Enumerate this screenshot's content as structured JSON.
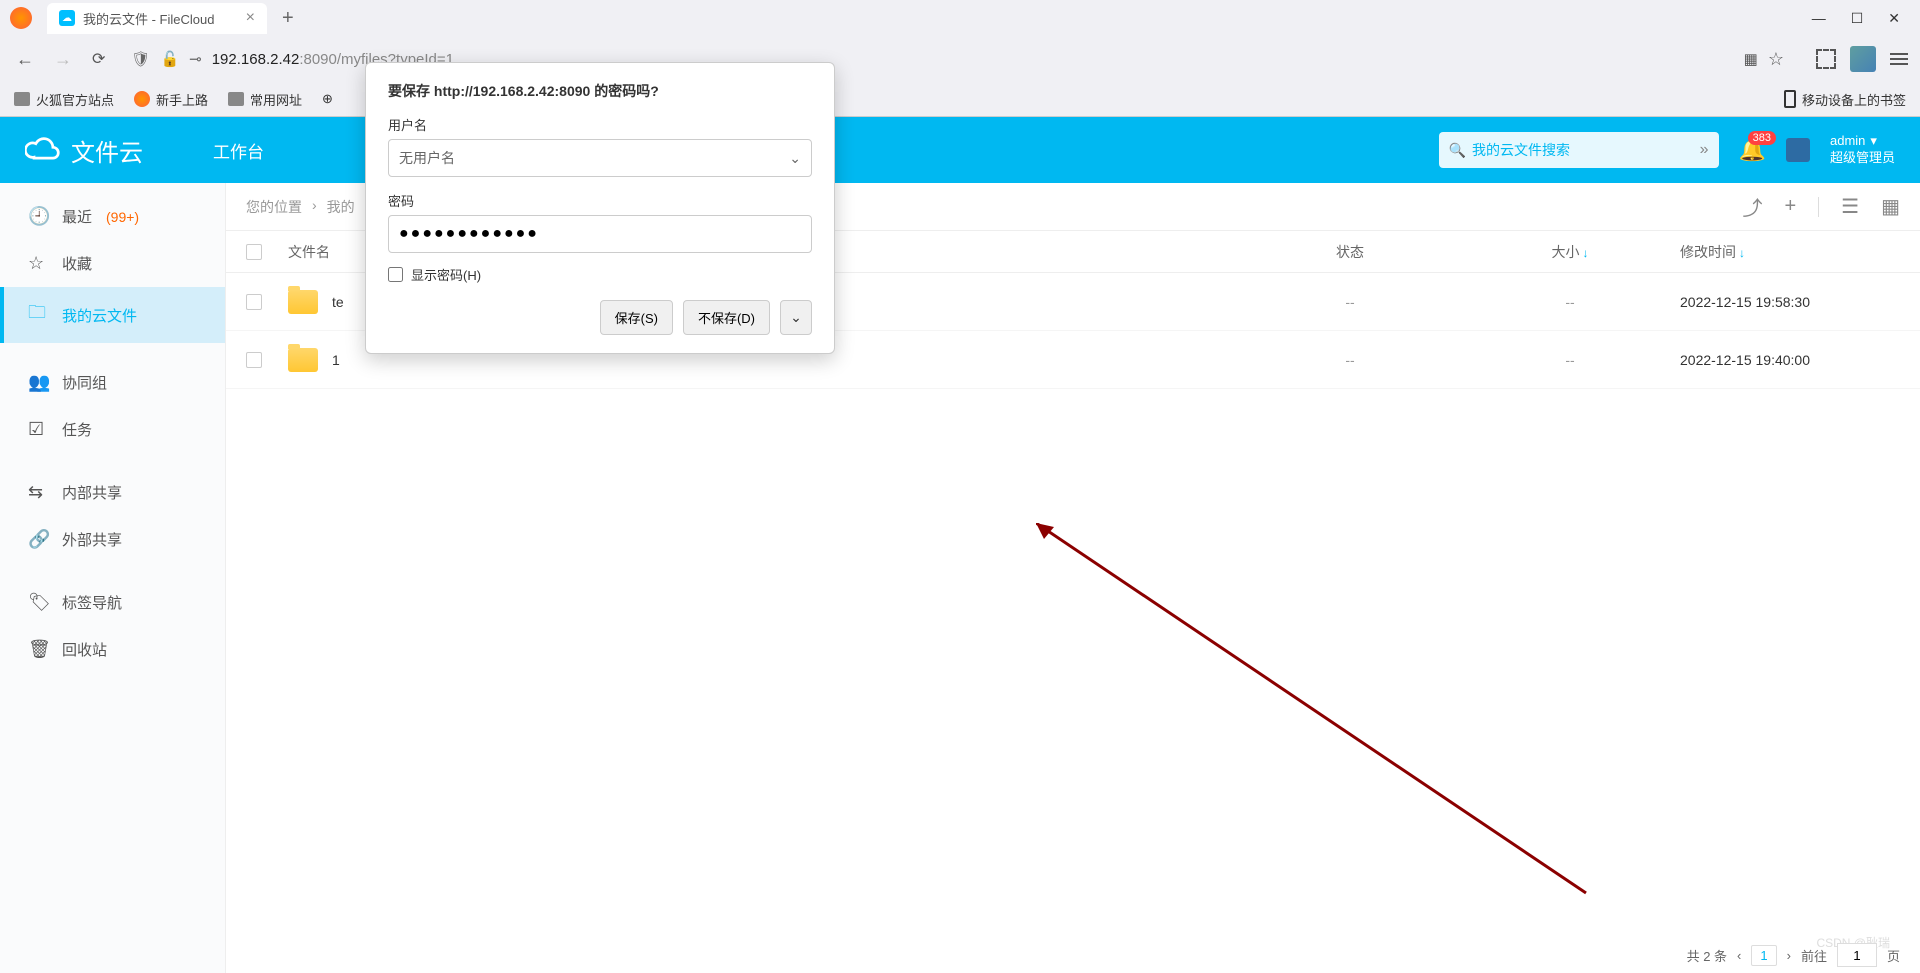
{
  "browser": {
    "tab_title": "我的云文件 - FileCloud",
    "url_dark": "192.168.2.42",
    "url_rest": ":8090/myfiles?typeId=1",
    "bookmarks": {
      "b1": "火狐官方站点",
      "b2": "新手上路",
      "b3": "常用网址",
      "mobile": "移动设备上的书签"
    }
  },
  "popup": {
    "title": "要保存 http://192.168.2.42:8090 的密码吗?",
    "user_label": "用户名",
    "user_value": "无用户名",
    "pass_label": "密码",
    "pass_value": "●●●●●●●●●●●●",
    "show_pass": "显示密码(H)",
    "save": "保存(S)",
    "dont_save": "不保存(D)"
  },
  "header": {
    "brand": "文件云",
    "workspace": "工作台",
    "search_placeholder": "我的云文件搜索",
    "badge": "383",
    "user": "admin",
    "role": "超级管理员"
  },
  "sidebar": {
    "recent": "最近",
    "recent_count": "(99+)",
    "fav": "收藏",
    "myfiles": "我的云文件",
    "group": "协同组",
    "task": "任务",
    "internal": "内部共享",
    "external": "外部共享",
    "tags": "标签导航",
    "trash": "回收站"
  },
  "breadcrumb": {
    "loc": "您的位置",
    "my": "我的"
  },
  "table": {
    "h_name": "文件名",
    "h_status": "状态",
    "h_size": "大小",
    "h_date": "修改时间",
    "rows": [
      {
        "name": "te",
        "status": "--",
        "size": "--",
        "date": "2022-12-15 19:58:30"
      },
      {
        "name": "1",
        "status": "--",
        "size": "--",
        "date": "2022-12-15 19:40:00"
      }
    ]
  },
  "pagination": {
    "total": "共 2 条",
    "page": "1",
    "goto": "前往",
    "page_input": "1",
    "page_unit": "页"
  },
  "watermark": "CSDN @耿瑞"
}
